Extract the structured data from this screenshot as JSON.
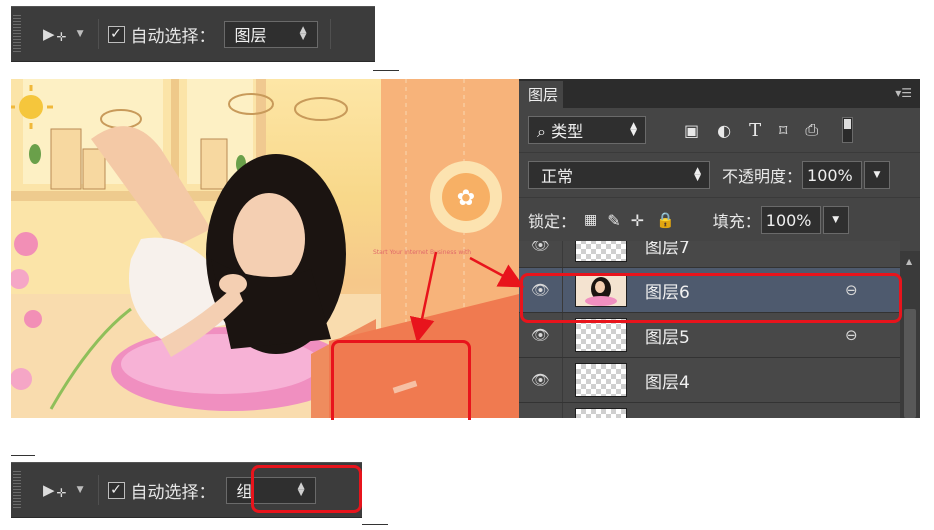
{
  "toolbar_top": {
    "move_tool_icon": "move-arrow-icon",
    "auto_select_checked": true,
    "check_mark": "✓",
    "auto_select_label": "自动选择：",
    "target_value": "图层"
  },
  "toolbar_bottom": {
    "move_tool_icon": "move-arrow-icon",
    "auto_select_checked": true,
    "check_mark": "✓",
    "auto_select_label": "自动选择：",
    "target_value": "组"
  },
  "canvas": {
    "overlay_text": "Start Your Internet Business with"
  },
  "layers_panel": {
    "tab_label": "图层",
    "filter_search_glyph": "⌕",
    "filter_type": "类型",
    "blend_mode": "正常",
    "opacity_label": "不透明度：",
    "opacity_value": "100%",
    "lock_label": "锁定：",
    "fill_label": "填充：",
    "fill_value": "100%",
    "layers": [
      {
        "name": "图层7",
        "selected": false,
        "linked": false
      },
      {
        "name": "图层6",
        "selected": true,
        "linked": true
      },
      {
        "name": "图层5",
        "selected": false,
        "linked": true
      },
      {
        "name": "图层4",
        "selected": false,
        "linked": false
      }
    ]
  },
  "colors": {
    "highlight": "#e8141c",
    "selected_row": "#4e5a6e",
    "panel_bg": "#454545"
  }
}
